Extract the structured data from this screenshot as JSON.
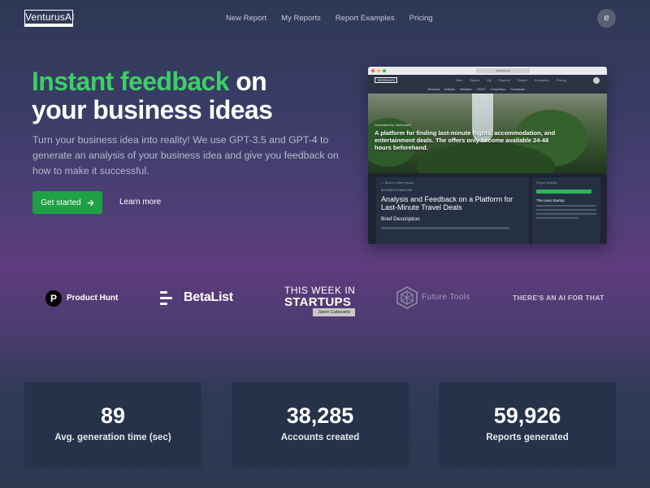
{
  "nav": {
    "logo": "VenturusAI",
    "links": [
      "New Report",
      "My Reports",
      "Report Examples",
      "Pricing"
    ],
    "avatar_initial": "e"
  },
  "hero": {
    "headline_accent": "Instant feedback",
    "headline_rest_1": " on",
    "headline_rest_2": "your business ideas",
    "subtitle": "Turn your business idea into reality! We use GPT-3.5 and GPT-4 to generate an analysis of your business idea and give you feedback on how to make it successful.",
    "primary_button": "Get started",
    "secondary_button": "Learn more",
    "accent_color": "#3ccf65",
    "button_color": "#1fa046"
  },
  "preview": {
    "url": "venturus.ai",
    "logo": "VenturusAI",
    "nav_links": "New Report My Reports Report Examples Pricing",
    "tabs": "Business Analysis Validation SWOT Competitors Framework",
    "hero_label": "Generated by VenturusAI",
    "hero_title": "A platform for finding last-minute flights, accommodation, and entertainment deals. The offers only become available 24-48 hours beforehand.",
    "back_link": "← Back to other reports",
    "section_label": "BUSINESS ANALYSIS",
    "report_title": "Analysis and Feedback on a Platform for Last-Minute Travel Deals",
    "brief": "Brief Description",
    "side_label": "Report visibility",
    "side_title": "The Lean Startup"
  },
  "logos": {
    "product_hunt": "Product Hunt",
    "product_hunt_icon": "P",
    "betalist": "BetaList",
    "twis_line1": "THIS WEEK IN",
    "twis_line2": "STARTUPS",
    "twis_badge": "Jason Calacanis",
    "future_tools": "Future Tools",
    "aai": "THERE'S AN AI FOR THAT"
  },
  "stats": [
    {
      "value": "89",
      "label": "Avg. generation time (sec)"
    },
    {
      "value": "38,285",
      "label": "Accounts created"
    },
    {
      "value": "59,926",
      "label": "Reports generated"
    }
  ]
}
